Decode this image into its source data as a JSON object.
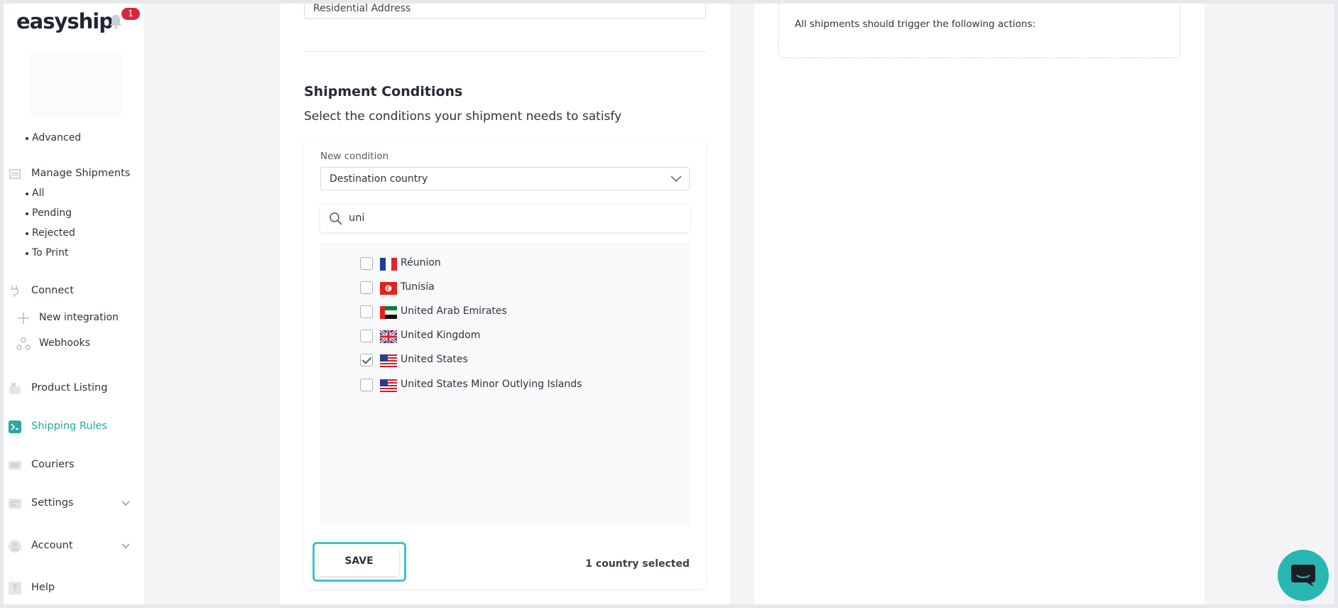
{
  "app": {
    "logo": "easyship",
    "notifications": "1"
  },
  "sidebar": {
    "advanced": "Advanced",
    "manage_shipments": "Manage Shipments",
    "shipment_sub": [
      "All",
      "Pending",
      "Rejected",
      "To Print"
    ],
    "connect": "Connect",
    "new_integration": "New integration",
    "webhooks": "Webhooks",
    "product_listing": "Product Listing",
    "shipping_rules": "Shipping Rules",
    "couriers": "Couriers",
    "settings": "Settings",
    "account": "Account",
    "help": "Help"
  },
  "form": {
    "residential_address": "Residential Address",
    "section_title": "Shipment Conditions",
    "section_subtitle": "Select the conditions your shipment needs to satisfy",
    "new_condition_label": "New condition",
    "condition_value": "Destination country",
    "search_value": "uni",
    "countries": [
      {
        "name": "Réunion",
        "checked": false,
        "flag": "fr"
      },
      {
        "name": "Tunisia",
        "checked": false,
        "flag": "tn"
      },
      {
        "name": "United Arab Emirates",
        "checked": false,
        "flag": "ae"
      },
      {
        "name": "United Kingdom",
        "checked": false,
        "flag": "gb"
      },
      {
        "name": "United States",
        "checked": true,
        "flag": "us"
      },
      {
        "name": "United States Minor Outlying Islands",
        "checked": false,
        "flag": "us"
      }
    ],
    "save_label": "SAVE",
    "selected_count": "1 country selected"
  },
  "actions": {
    "text": "All shipments should trigger the following actions:"
  },
  "colors": {
    "accent": "#29a7a3",
    "focus": "#3fc3cb",
    "chat": "#29b6b2",
    "badge": "#d7263d"
  }
}
